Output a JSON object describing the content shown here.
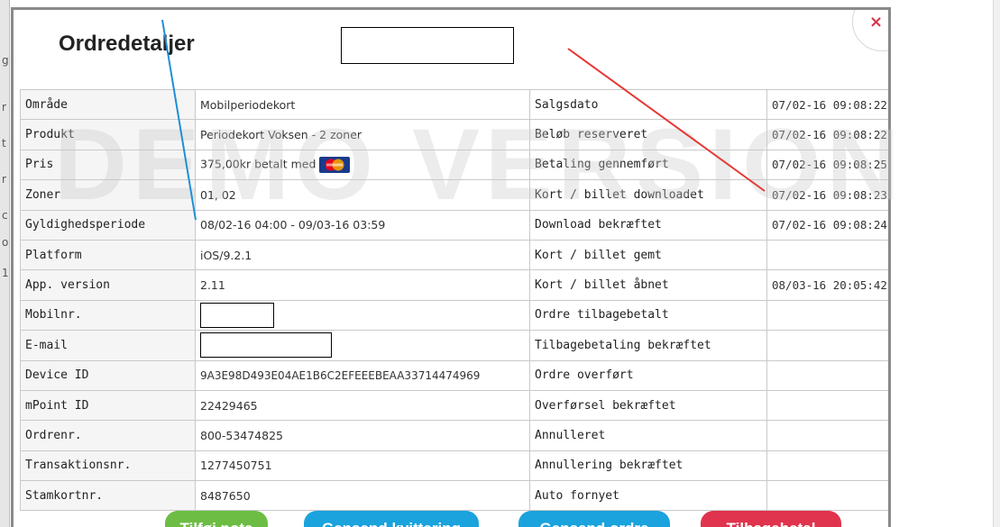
{
  "modal": {
    "title": "Ordredetaljer",
    "close_icon": "close-icon",
    "close_glyph": "×"
  },
  "details_rows": [
    {
      "label": "Område",
      "value": "Mobilperiodekort",
      "event": "Salgsdato",
      "time": "07/02-16 09:08:22"
    },
    {
      "label": "Produkt",
      "value": "Periodekort Voksen - 2 zoner",
      "event": "Beløb reserveret",
      "time": "07/02-16 09:08:22"
    },
    {
      "label": "Pris",
      "value": "375,00kr betalt med",
      "event": "Betaling gennemført",
      "time": "07/02-16 09:08:25"
    },
    {
      "label": "Zoner",
      "value": "01, 02",
      "event": "Kort / billet downloadet",
      "time": "07/02-16 09:08:23"
    },
    {
      "label": "Gyldighedsperiode",
      "value": "08/02-16 04:00 - 09/03-16 03:59",
      "event": "Download bekræftet",
      "time": "07/02-16 09:08:24"
    },
    {
      "label": "Platform",
      "value": "iOS/9.2.1",
      "event": "Kort / billet gemt",
      "time": ""
    },
    {
      "label": "App. version",
      "value": "2.11",
      "event": "Kort / billet åbnet",
      "time": "08/03-16 20:05:42"
    },
    {
      "label": "Mobilnr.",
      "value": "",
      "event": "Ordre tilbagebetalt",
      "time": ""
    },
    {
      "label": "E-mail",
      "value": "",
      "event": "Tilbagebetaling bekræftet",
      "time": ""
    },
    {
      "label": "Device ID",
      "value": "9A3E98D493E04AE1B6C2EFEEEBEAA33714474969",
      "event": "Ordre overført",
      "time": ""
    },
    {
      "label": "mPoint ID",
      "value": "22429465",
      "event": "Overførsel bekræftet",
      "time": ""
    },
    {
      "label": "Ordrenr.",
      "value": "800-53474825",
      "event": "Annulleret",
      "time": ""
    },
    {
      "label": "Transaktionsnr.",
      "value": "1277450751",
      "event": "Annullering bekræftet",
      "time": ""
    },
    {
      "label": "Stamkortnr.",
      "value": "8487650",
      "event": "Auto fornyet",
      "time": ""
    }
  ],
  "payment_icon": "mastercard-icon",
  "watermark": "DEMO VERSION",
  "buttons": [
    {
      "label": "Tilføj note",
      "color": "#6dbd45"
    },
    {
      "label": "Gensend kvittering",
      "color": "#1ba3dd"
    },
    {
      "label": "Gensend ordre",
      "color": "#1ba3dd"
    },
    {
      "label": "Tilbagebetal",
      "color": "#e0344e"
    }
  ],
  "colors": {
    "accent_red": "#d9324a",
    "annotation_blue": "#1e8fd6",
    "annotation_red": "#e53935"
  }
}
